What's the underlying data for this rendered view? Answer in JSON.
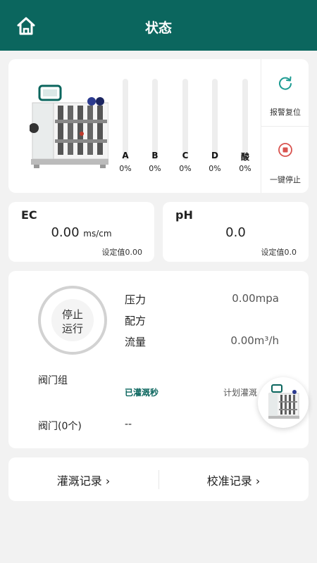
{
  "header": {
    "title": "状态"
  },
  "tanks": [
    {
      "label": "A",
      "value": "0%",
      "level": 0
    },
    {
      "label": "B",
      "value": "0%",
      "level": 0
    },
    {
      "label": "C",
      "value": "0%",
      "level": 0
    },
    {
      "label": "D",
      "value": "0%",
      "level": 0
    },
    {
      "label": "酸",
      "value": "0%",
      "level": 0
    }
  ],
  "side": {
    "alarm_reset": "报警复位",
    "stop_all": "一键停止"
  },
  "ec": {
    "title": "EC",
    "value": "0.00",
    "unit": "ms/cm",
    "setpoint": "设定值0.00"
  },
  "ph": {
    "title": "pH",
    "value": "0.0",
    "setpoint": "设定值0.0"
  },
  "run": {
    "line1": "停止",
    "line2": "运行"
  },
  "params": [
    {
      "key": "压力",
      "value": "0.00mpa"
    },
    {
      "key": "配方",
      "value": ""
    },
    {
      "key": "流量",
      "value": "0.00m³/h"
    }
  ],
  "valves": {
    "group_label": "阀门组",
    "irrigated": "已灌溉秒",
    "planned": "计划灌溉",
    "count_label": "阀门(0个)",
    "count_value": "--"
  },
  "records": {
    "irrigation": "灌溉记录 ›",
    "calibration": "校准记录 ›"
  },
  "colors": {
    "primary": "#0b665e",
    "background": "#f2f2f2",
    "stop_red": "#d9534f",
    "reset_teal": "#1d9b92"
  }
}
